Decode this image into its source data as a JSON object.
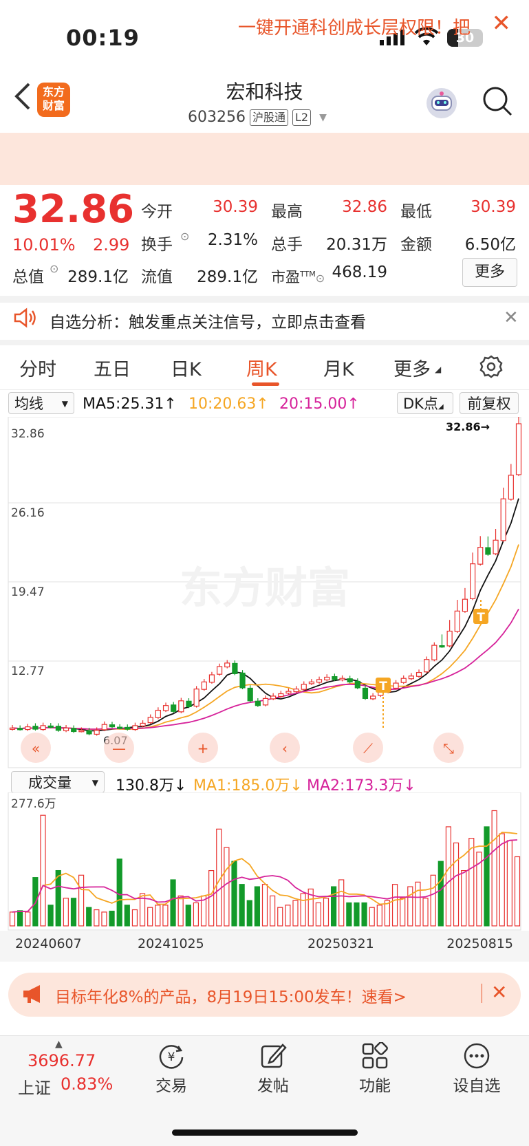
{
  "status_bar": {
    "time": "00:19",
    "battery": "30"
  },
  "header": {
    "stock_name": "宏和科技",
    "stock_code": "603256",
    "badge_market": "沪股通",
    "badge_level": "L2",
    "logo_line1": "东方",
    "logo_line2": "财富"
  },
  "promo": {
    "text": "一键开通科创成长层权限！把"
  },
  "quote": {
    "price": "32.86",
    "pct": "10.01%",
    "change": "2.99",
    "fields": [
      {
        "label": "今开",
        "value": "30.39",
        "color": "#e8312f"
      },
      {
        "label": "最高",
        "value": "32.86",
        "color": "#e8312f"
      },
      {
        "label": "最低",
        "value": "30.39",
        "color": "#e8312f"
      },
      {
        "label": "换手",
        "value": "2.31%",
        "color": "#222222"
      },
      {
        "label": "总手",
        "value": "20.31万",
        "color": "#222222"
      },
      {
        "label": "金额",
        "value": "6.50亿",
        "color": "#222222"
      },
      {
        "label": "总值",
        "value": "289.1亿",
        "color": "#222222"
      },
      {
        "label": "流值",
        "value": "289.1亿",
        "color": "#222222"
      },
      {
        "label": "市盈",
        "value": "468.19",
        "color": "#222222",
        "sup": "TTM"
      }
    ],
    "more": "更多"
  },
  "analysis": {
    "text": "自选分析：触发重点关注信号，立即点击查看"
  },
  "tabs": [
    "分时",
    "五日",
    "日K",
    "周K",
    "月K",
    "更多"
  ],
  "active_tab": "周K",
  "chart_toolbar": {
    "indicator": "均线",
    "ma5": "MA5:25.31↑",
    "ma10": "10:20.63↑",
    "ma20": "20:15.00↑",
    "dk": "DK点",
    "adjust": "前复权"
  },
  "volume_toolbar": {
    "indicator": "成交量",
    "vol": "130.8万↓",
    "ma1": "MA1:185.0万↓",
    "ma2": "MA2:173.3万↓"
  },
  "chart_data": [
    {
      "type": "candlestick",
      "y_ticks": [
        "32.86",
        "26.16",
        "19.47",
        "12.77"
      ],
      "y_bottom_label": "6.07",
      "y_range": [
        6.07,
        32.86
      ],
      "latest_marker": "32.86→",
      "watermark": "东方财富",
      "signal_markers": [
        "T",
        "T"
      ],
      "colors": {
        "up": "#e8312f",
        "down": "#139a2a",
        "ma5": "#111111",
        "ma10": "#f5a623",
        "ma20": "#d6229a"
      },
      "close": [
        7.1,
        7.0,
        7.2,
        7.0,
        7.3,
        7.2,
        6.9,
        7.1,
        6.8,
        6.9,
        6.6,
        6.9,
        7.4,
        7.2,
        7.1,
        7.0,
        7.3,
        7.5,
        8.0,
        8.6,
        9.0,
        8.5,
        9.4,
        8.9,
        10.4,
        11.0,
        11.6,
        12.3,
        12.6,
        11.7,
        10.5,
        9.4,
        9.0,
        9.6,
        9.8,
        10.0,
        10.2,
        10.4,
        10.8,
        11.0,
        11.2,
        11.4,
        11.2,
        11.3,
        11.0,
        10.5,
        9.6,
        9.8,
        10.2,
        10.5,
        10.9,
        11.3,
        11.5,
        11.8,
        12.9,
        14.1,
        14.0,
        15.3,
        17.0,
        18.0,
        21.0,
        22.4,
        21.8,
        23.0,
        26.5,
        28.5,
        32.86
      ],
      "series": [
        {
          "name": "MA5",
          "value": "25.31"
        },
        {
          "name": "MA10",
          "value": "20.63"
        },
        {
          "name": "MA20",
          "value": "15.00"
        }
      ]
    },
    {
      "type": "bar",
      "title": "成交量",
      "y_max_label": "277.6万",
      "x_labels": [
        "20240607",
        "20241025",
        "20250321",
        "20250815"
      ],
      "values": [
        30,
        33,
        30,
        105,
        240,
        45,
        120,
        60,
        60,
        110,
        40,
        35,
        30,
        32,
        145,
        45,
        35,
        70,
        40,
        45,
        45,
        100,
        65,
        45,
        50,
        65,
        120,
        210,
        170,
        140,
        90,
        55,
        85,
        90,
        65,
        40,
        45,
        55,
        70,
        80,
        50,
        60,
        85,
        100,
        50,
        50,
        50,
        40,
        45,
        55,
        90,
        60,
        85,
        95,
        60,
        110,
        140,
        215,
        180,
        120,
        190,
        160,
        215,
        250,
        200,
        185,
        150
      ]
    }
  ],
  "ad": {
    "text": "目标年化8%的产品，8月19日15:00发车！速看>"
  },
  "bottom_nav": {
    "index_value": "3696.77",
    "index_name": "上证",
    "index_pct": "0.83%",
    "items": [
      "交易",
      "发帖",
      "功能",
      "设自选"
    ]
  }
}
